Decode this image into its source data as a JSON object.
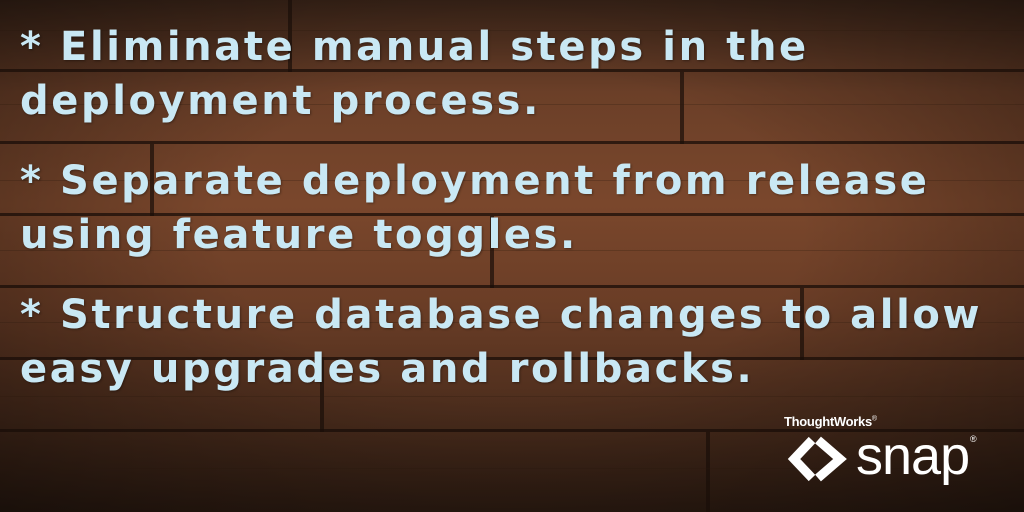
{
  "bullets": [
    "* Eliminate manual steps in the deployment process.",
    "* Separate deployment from release using feature toggles.",
    "* Structure database changes to allow easy upgrades and rollbacks."
  ],
  "logo": {
    "company": "ThoughtWorks",
    "company_mark": "®",
    "product": "snap",
    "product_mark": "®"
  },
  "colors": {
    "text": "#c9e8f4",
    "wood": "#6b3f28",
    "logo": "#ffffff"
  }
}
